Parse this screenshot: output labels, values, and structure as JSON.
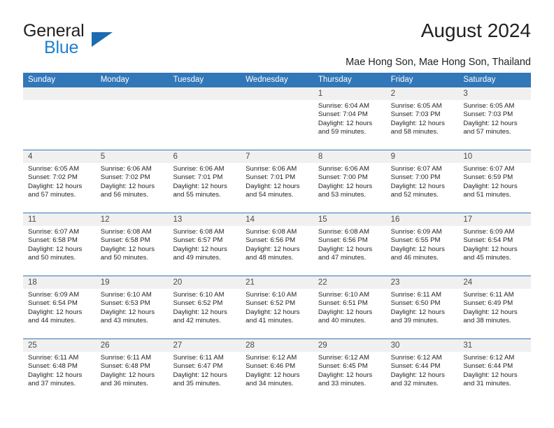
{
  "brand": {
    "name_part1": "General",
    "name_part2": "Blue",
    "triangle_color": "#1b6cb0",
    "blue_text_color": "#1f7fd0"
  },
  "header": {
    "title": "August 2024",
    "location": "Mae Hong Son, Mae Hong Son, Thailand"
  },
  "theme": {
    "header_blue": "#3277b8",
    "date_band_gray": "#f0f0f0",
    "text_dark": "#231f20"
  },
  "calendar": {
    "weekday_headers": [
      "Sunday",
      "Monday",
      "Tuesday",
      "Wednesday",
      "Thursday",
      "Friday",
      "Saturday"
    ],
    "weeks": [
      {
        "days": [
          {
            "num": "",
            "sunrise": "",
            "sunset": "",
            "daylight_1": "",
            "daylight_2": "",
            "empty": true
          },
          {
            "num": "",
            "sunrise": "",
            "sunset": "",
            "daylight_1": "",
            "daylight_2": "",
            "empty": true
          },
          {
            "num": "",
            "sunrise": "",
            "sunset": "",
            "daylight_1": "",
            "daylight_2": "",
            "empty": true
          },
          {
            "num": "",
            "sunrise": "",
            "sunset": "",
            "daylight_1": "",
            "daylight_2": "",
            "empty": true
          },
          {
            "num": "1",
            "sunrise": "Sunrise: 6:04 AM",
            "sunset": "Sunset: 7:04 PM",
            "daylight_1": "Daylight: 12 hours",
            "daylight_2": "and 59 minutes.",
            "empty": false
          },
          {
            "num": "2",
            "sunrise": "Sunrise: 6:05 AM",
            "sunset": "Sunset: 7:03 PM",
            "daylight_1": "Daylight: 12 hours",
            "daylight_2": "and 58 minutes.",
            "empty": false
          },
          {
            "num": "3",
            "sunrise": "Sunrise: 6:05 AM",
            "sunset": "Sunset: 7:03 PM",
            "daylight_1": "Daylight: 12 hours",
            "daylight_2": "and 57 minutes.",
            "empty": false
          }
        ]
      },
      {
        "days": [
          {
            "num": "4",
            "sunrise": "Sunrise: 6:05 AM",
            "sunset": "Sunset: 7:02 PM",
            "daylight_1": "Daylight: 12 hours",
            "daylight_2": "and 57 minutes.",
            "empty": false
          },
          {
            "num": "5",
            "sunrise": "Sunrise: 6:06 AM",
            "sunset": "Sunset: 7:02 PM",
            "daylight_1": "Daylight: 12 hours",
            "daylight_2": "and 56 minutes.",
            "empty": false
          },
          {
            "num": "6",
            "sunrise": "Sunrise: 6:06 AM",
            "sunset": "Sunset: 7:01 PM",
            "daylight_1": "Daylight: 12 hours",
            "daylight_2": "and 55 minutes.",
            "empty": false
          },
          {
            "num": "7",
            "sunrise": "Sunrise: 6:06 AM",
            "sunset": "Sunset: 7:01 PM",
            "daylight_1": "Daylight: 12 hours",
            "daylight_2": "and 54 minutes.",
            "empty": false
          },
          {
            "num": "8",
            "sunrise": "Sunrise: 6:06 AM",
            "sunset": "Sunset: 7:00 PM",
            "daylight_1": "Daylight: 12 hours",
            "daylight_2": "and 53 minutes.",
            "empty": false
          },
          {
            "num": "9",
            "sunrise": "Sunrise: 6:07 AM",
            "sunset": "Sunset: 7:00 PM",
            "daylight_1": "Daylight: 12 hours",
            "daylight_2": "and 52 minutes.",
            "empty": false
          },
          {
            "num": "10",
            "sunrise": "Sunrise: 6:07 AM",
            "sunset": "Sunset: 6:59 PM",
            "daylight_1": "Daylight: 12 hours",
            "daylight_2": "and 51 minutes.",
            "empty": false
          }
        ]
      },
      {
        "days": [
          {
            "num": "11",
            "sunrise": "Sunrise: 6:07 AM",
            "sunset": "Sunset: 6:58 PM",
            "daylight_1": "Daylight: 12 hours",
            "daylight_2": "and 50 minutes.",
            "empty": false
          },
          {
            "num": "12",
            "sunrise": "Sunrise: 6:08 AM",
            "sunset": "Sunset: 6:58 PM",
            "daylight_1": "Daylight: 12 hours",
            "daylight_2": "and 50 minutes.",
            "empty": false
          },
          {
            "num": "13",
            "sunrise": "Sunrise: 6:08 AM",
            "sunset": "Sunset: 6:57 PM",
            "daylight_1": "Daylight: 12 hours",
            "daylight_2": "and 49 minutes.",
            "empty": false
          },
          {
            "num": "14",
            "sunrise": "Sunrise: 6:08 AM",
            "sunset": "Sunset: 6:56 PM",
            "daylight_1": "Daylight: 12 hours",
            "daylight_2": "and 48 minutes.",
            "empty": false
          },
          {
            "num": "15",
            "sunrise": "Sunrise: 6:08 AM",
            "sunset": "Sunset: 6:56 PM",
            "daylight_1": "Daylight: 12 hours",
            "daylight_2": "and 47 minutes.",
            "empty": false
          },
          {
            "num": "16",
            "sunrise": "Sunrise: 6:09 AM",
            "sunset": "Sunset: 6:55 PM",
            "daylight_1": "Daylight: 12 hours",
            "daylight_2": "and 46 minutes.",
            "empty": false
          },
          {
            "num": "17",
            "sunrise": "Sunrise: 6:09 AM",
            "sunset": "Sunset: 6:54 PM",
            "daylight_1": "Daylight: 12 hours",
            "daylight_2": "and 45 minutes.",
            "empty": false
          }
        ]
      },
      {
        "days": [
          {
            "num": "18",
            "sunrise": "Sunrise: 6:09 AM",
            "sunset": "Sunset: 6:54 PM",
            "daylight_1": "Daylight: 12 hours",
            "daylight_2": "and 44 minutes.",
            "empty": false
          },
          {
            "num": "19",
            "sunrise": "Sunrise: 6:10 AM",
            "sunset": "Sunset: 6:53 PM",
            "daylight_1": "Daylight: 12 hours",
            "daylight_2": "and 43 minutes.",
            "empty": false
          },
          {
            "num": "20",
            "sunrise": "Sunrise: 6:10 AM",
            "sunset": "Sunset: 6:52 PM",
            "daylight_1": "Daylight: 12 hours",
            "daylight_2": "and 42 minutes.",
            "empty": false
          },
          {
            "num": "21",
            "sunrise": "Sunrise: 6:10 AM",
            "sunset": "Sunset: 6:52 PM",
            "daylight_1": "Daylight: 12 hours",
            "daylight_2": "and 41 minutes.",
            "empty": false
          },
          {
            "num": "22",
            "sunrise": "Sunrise: 6:10 AM",
            "sunset": "Sunset: 6:51 PM",
            "daylight_1": "Daylight: 12 hours",
            "daylight_2": "and 40 minutes.",
            "empty": false
          },
          {
            "num": "23",
            "sunrise": "Sunrise: 6:11 AM",
            "sunset": "Sunset: 6:50 PM",
            "daylight_1": "Daylight: 12 hours",
            "daylight_2": "and 39 minutes.",
            "empty": false
          },
          {
            "num": "24",
            "sunrise": "Sunrise: 6:11 AM",
            "sunset": "Sunset: 6:49 PM",
            "daylight_1": "Daylight: 12 hours",
            "daylight_2": "and 38 minutes.",
            "empty": false
          }
        ]
      },
      {
        "days": [
          {
            "num": "25",
            "sunrise": "Sunrise: 6:11 AM",
            "sunset": "Sunset: 6:48 PM",
            "daylight_1": "Daylight: 12 hours",
            "daylight_2": "and 37 minutes.",
            "empty": false
          },
          {
            "num": "26",
            "sunrise": "Sunrise: 6:11 AM",
            "sunset": "Sunset: 6:48 PM",
            "daylight_1": "Daylight: 12 hours",
            "daylight_2": "and 36 minutes.",
            "empty": false
          },
          {
            "num": "27",
            "sunrise": "Sunrise: 6:11 AM",
            "sunset": "Sunset: 6:47 PM",
            "daylight_1": "Daylight: 12 hours",
            "daylight_2": "and 35 minutes.",
            "empty": false
          },
          {
            "num": "28",
            "sunrise": "Sunrise: 6:12 AM",
            "sunset": "Sunset: 6:46 PM",
            "daylight_1": "Daylight: 12 hours",
            "daylight_2": "and 34 minutes.",
            "empty": false
          },
          {
            "num": "29",
            "sunrise": "Sunrise: 6:12 AM",
            "sunset": "Sunset: 6:45 PM",
            "daylight_1": "Daylight: 12 hours",
            "daylight_2": "and 33 minutes.",
            "empty": false
          },
          {
            "num": "30",
            "sunrise": "Sunrise: 6:12 AM",
            "sunset": "Sunset: 6:44 PM",
            "daylight_1": "Daylight: 12 hours",
            "daylight_2": "and 32 minutes.",
            "empty": false
          },
          {
            "num": "31",
            "sunrise": "Sunrise: 6:12 AM",
            "sunset": "Sunset: 6:44 PM",
            "daylight_1": "Daylight: 12 hours",
            "daylight_2": "and 31 minutes.",
            "empty": false
          }
        ]
      }
    ]
  }
}
